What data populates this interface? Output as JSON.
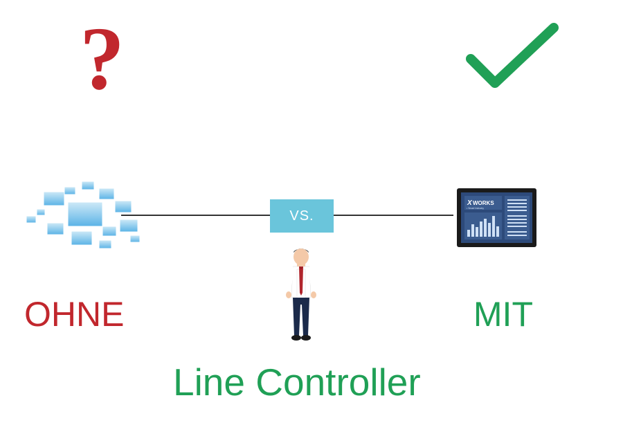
{
  "top": {
    "question_mark": "?",
    "check_color": "#20a056"
  },
  "middle": {
    "vs_label": "VS."
  },
  "labels": {
    "ohne": "OHNE",
    "mit": "MIT",
    "title": "Line Controller"
  },
  "dashboard": {
    "brand_x": "X",
    "brand_works": "WORKS",
    "brand_sub": "Smart Industry"
  },
  "colors": {
    "red": "#c1272d",
    "green": "#20a056",
    "vs_bg": "#6ac5db"
  }
}
